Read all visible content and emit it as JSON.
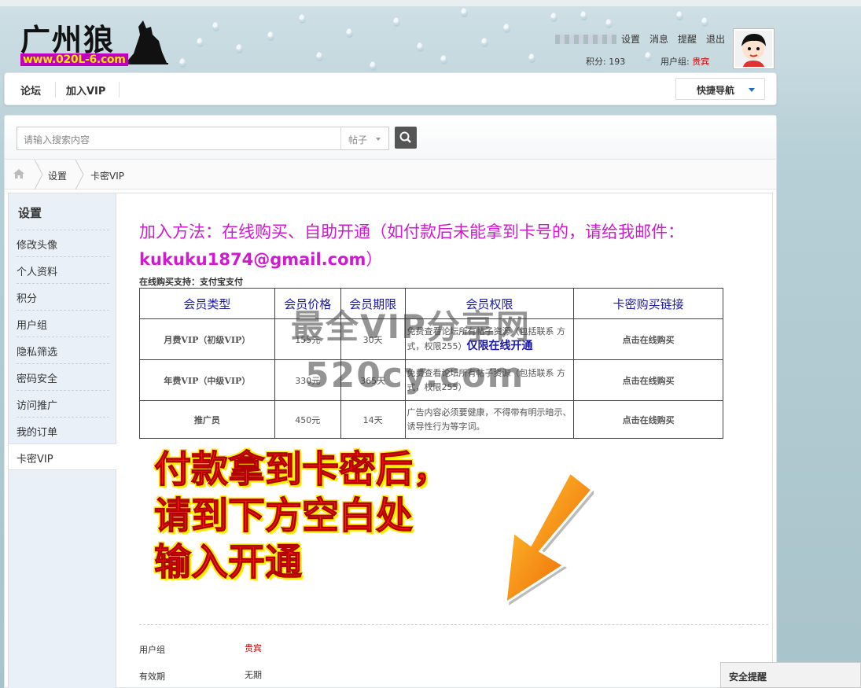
{
  "site": {
    "logo_cn": "广州狼",
    "logo_url": "www.020L-6.com"
  },
  "user": {
    "links": [
      "设置",
      "消息",
      "提醒",
      "退出"
    ],
    "credits_label": "积分: 193",
    "group_label": "用户组: ",
    "group_value": "贵宾"
  },
  "nav": {
    "items": [
      "论坛",
      "加入VIP"
    ],
    "quick_nav": "快捷导航"
  },
  "search": {
    "placeholder": "请输入搜索内容",
    "type": "帖子"
  },
  "breadcrumb": [
    "设置",
    "卡密VIP"
  ],
  "sidebar": {
    "title": "设置",
    "items": [
      "修改头像",
      "个人资料",
      "积分",
      "用户组",
      "隐私筛选",
      "密码安全",
      "访问推广",
      "我的订单",
      "卡密VIP"
    ],
    "active_index": 8
  },
  "content": {
    "join_text": "加入方法：在线购买、自助开通（如付款后未能拿到卡号的，请给我邮件：",
    "join_email": "kukuku1874@gmail.com",
    "join_close": "）",
    "pay_support": "在线购买支持：支付宝支付",
    "table": {
      "headers": [
        "会员类型",
        "会员价格",
        "会员期限",
        "会员权限",
        "卡密购买链接"
      ],
      "rows": [
        {
          "type": "月费VIP（初级VIP）",
          "price": "155元",
          "term": "30天",
          "perm": "免费查看论坛所有帖子资源（包括联系 方式，权限255）",
          "perm_extra": "仅限在线开通",
          "link": "点击在线购买"
        },
        {
          "type": "年费VIP（中级VIP）",
          "price": "330元",
          "term": "365天",
          "perm": "免费查看论坛所有帖子资源（包括联系 方式，权限255）",
          "perm_extra": "",
          "link": "点击在线购买"
        },
        {
          "type": "推广员",
          "price": "450元",
          "term": "14天",
          "perm": "广告内容必须要健康，不得带有明示暗示、诱导性行为等字词。",
          "perm_extra": "",
          "link": "点击在线购买"
        }
      ]
    },
    "watermark": [
      "最全VIP分享网",
      "520cy.com"
    ],
    "big_notice": [
      "付款拿到卡密后，",
      "请到下方空白处",
      "输入开通"
    ],
    "info": [
      {
        "label": "用户组",
        "value": "贵宾"
      },
      {
        "label": "有效期",
        "value": "无期"
      }
    ]
  },
  "safety": "安全提醒"
}
